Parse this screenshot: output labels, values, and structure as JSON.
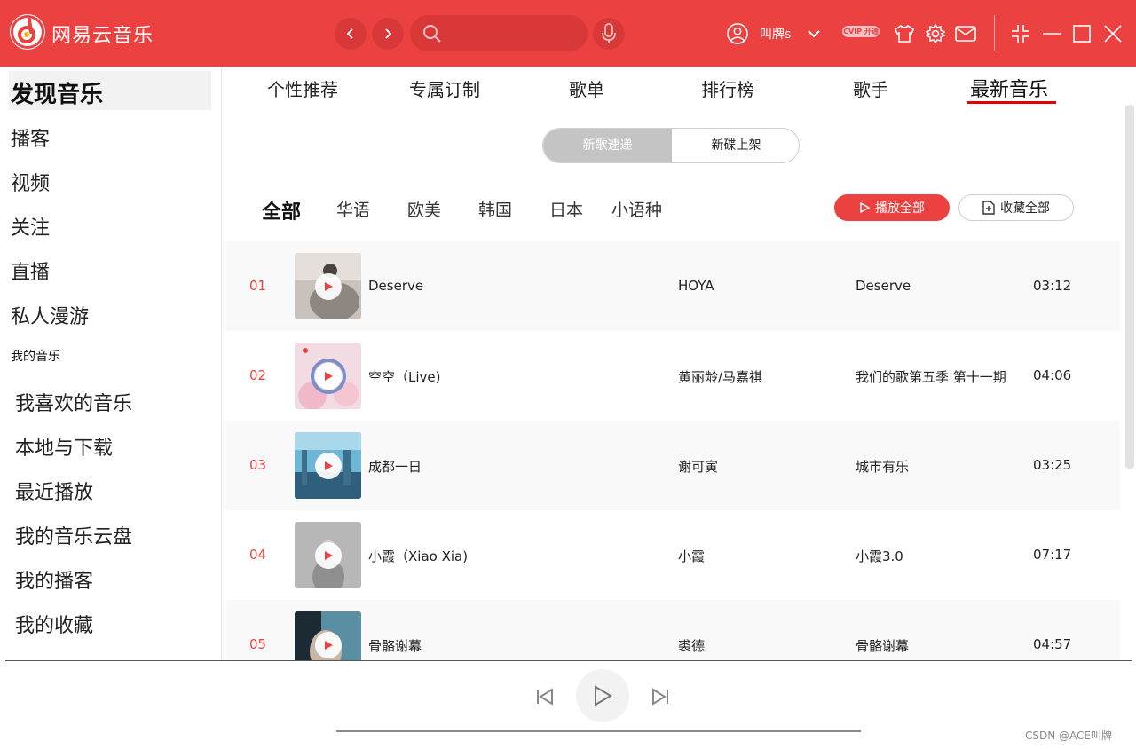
{
  "header": {
    "app_title": "网易云音乐",
    "username": "叫牌s",
    "vip_badge": "CVIP 开通",
    "search": {
      "value": "",
      "placeholder": ""
    }
  },
  "sidebar": {
    "active_item": "发现音乐",
    "items": [
      "播客",
      "视频",
      "关注",
      "直播",
      "私人漫游"
    ],
    "my_music_title": "我的音乐",
    "my_music_items": [
      "我喜欢的音乐",
      "本地与下载",
      "最近播放",
      "我的音乐云盘",
      "我的播客",
      "我的收藏"
    ]
  },
  "tabs": [
    {
      "label": "个性推荐"
    },
    {
      "label": "专属订制"
    },
    {
      "label": "歌单"
    },
    {
      "label": "排行榜"
    },
    {
      "label": "歌手"
    },
    {
      "label": "最新音乐",
      "active": true
    }
  ],
  "segment": {
    "left_label": "新歌速递",
    "right_label": "新碟上架",
    "active": "left"
  },
  "regions": [
    "全部",
    "华语",
    "欧美",
    "韩国",
    "日本",
    "小语种"
  ],
  "actions": {
    "play_all": "播放全部",
    "collect_all": "收藏全部"
  },
  "songs": [
    {
      "no": "01",
      "title": "Deserve",
      "artist": "HOYA",
      "album": "Deserve",
      "duration": "03:12"
    },
    {
      "no": "02",
      "title": "空空（Live)",
      "artist": "黄丽龄/马嘉祺",
      "album": "我们的歌第五季 第十一期",
      "duration": "04:06"
    },
    {
      "no": "03",
      "title": "成都一日",
      "artist": "谢可寅",
      "album": "城市有乐",
      "duration": "03:25"
    },
    {
      "no": "04",
      "title": "小霞（Xiao Xia)",
      "artist": "小霞",
      "album": "小霞3.0",
      "duration": "07:17"
    },
    {
      "no": "05",
      "title": "骨骼谢幕",
      "artist": "裘德",
      "album": "骨骼谢幕",
      "duration": "04:57"
    }
  ],
  "colors": {
    "brand": "#ec4141",
    "accent_underline": "#e00000"
  },
  "watermark": "CSDN @ACE叫牌"
}
